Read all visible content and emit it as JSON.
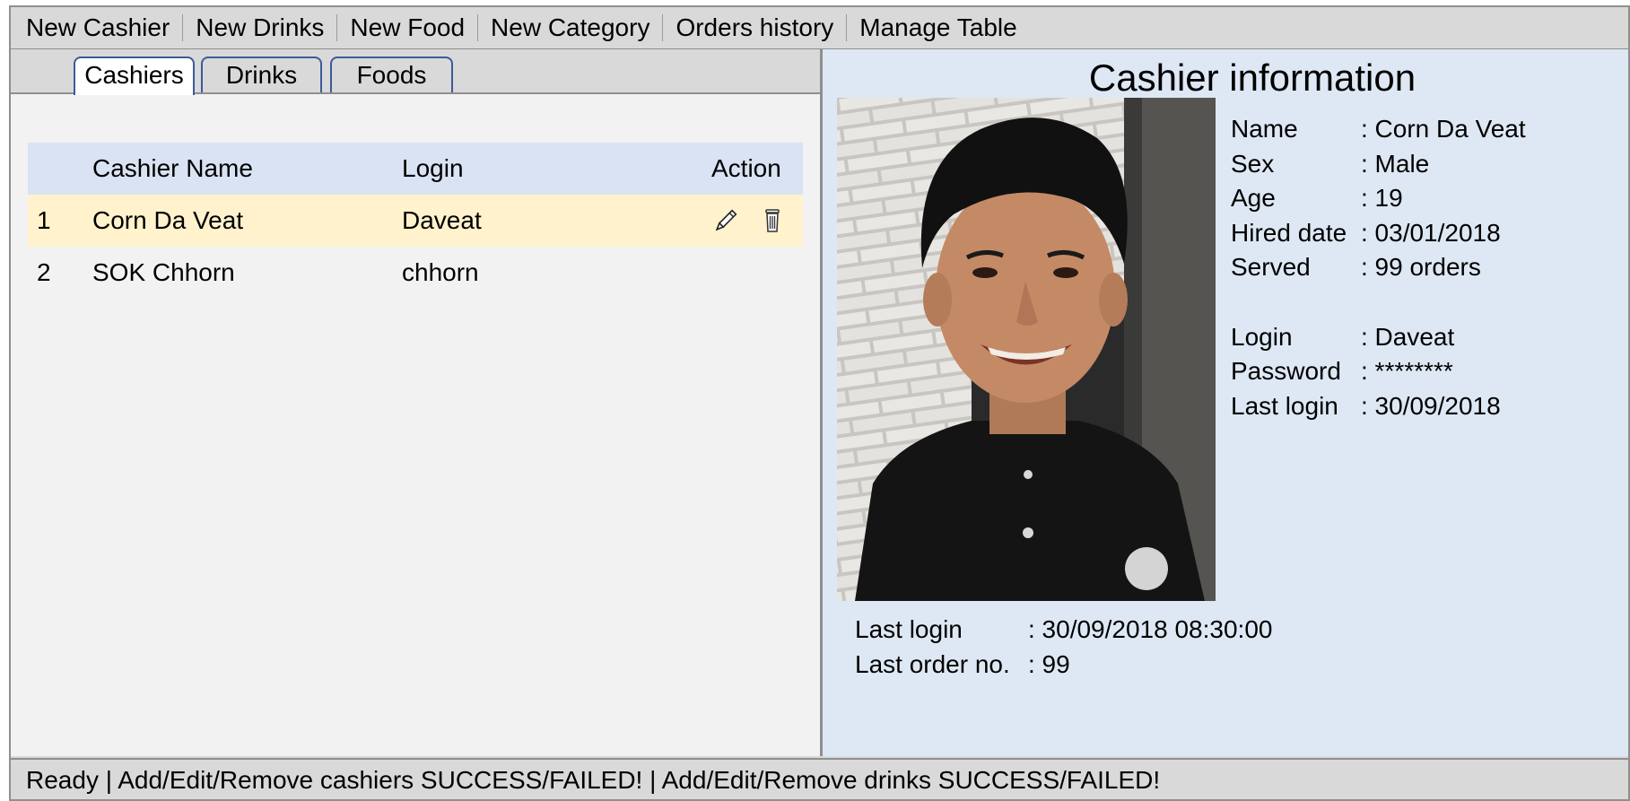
{
  "menu": {
    "items": [
      {
        "label": "New Cashier"
      },
      {
        "label": "New Drinks"
      },
      {
        "label": "New Food"
      },
      {
        "label": "New Category"
      },
      {
        "label": "Orders history"
      },
      {
        "label": "Manage Table"
      }
    ]
  },
  "tabs": [
    {
      "label": "Cashiers",
      "active": true
    },
    {
      "label": "Drinks"
    },
    {
      "label": "Foods"
    }
  ],
  "table": {
    "headers": {
      "num": "",
      "name": "Cashier Name",
      "login": "Login",
      "action": "Action"
    },
    "rows": [
      {
        "num": "1",
        "name": "Corn Da Veat",
        "login": "Daveat",
        "selected": true,
        "actions": [
          "pencil-icon",
          "trash-icon"
        ]
      },
      {
        "num": "2",
        "name": "SOK Chhorn",
        "login": "chhorn"
      }
    ]
  },
  "info": {
    "title": "Cashier information",
    "fields": [
      {
        "key": "Name",
        "value": ": Corn Da Veat"
      },
      {
        "key": "Sex",
        "value": ": Male"
      },
      {
        "key": "Age",
        "value": ": 19"
      },
      {
        "key": "Hired date",
        "value": ": 03/01/2018"
      },
      {
        "key": "Served",
        "value": ": 99 orders"
      },
      {
        "key": "Login",
        "value": ": Daveat"
      },
      {
        "key": "Password",
        "value": ": ********"
      },
      {
        "key": "Last login",
        "value": ": 30/09/2018"
      }
    ],
    "bottom": [
      {
        "key": "Last login",
        "value": ": 30/09/2018 08:30:00"
      },
      {
        "key": "Last order no.",
        "value": ": 99"
      }
    ]
  },
  "status": {
    "text": "Ready | Add/Edit/Remove cashiers SUCCESS/FAILED! | Add/Edit/Remove drinks SUCCESS/FAILED!"
  },
  "colors": {
    "chrome": "#d9d9d9",
    "header_row": "#dae3f3",
    "selected_row": "#fff2cc",
    "info_panel": "#dee8f4",
    "tab_border": "#3d5a99"
  }
}
